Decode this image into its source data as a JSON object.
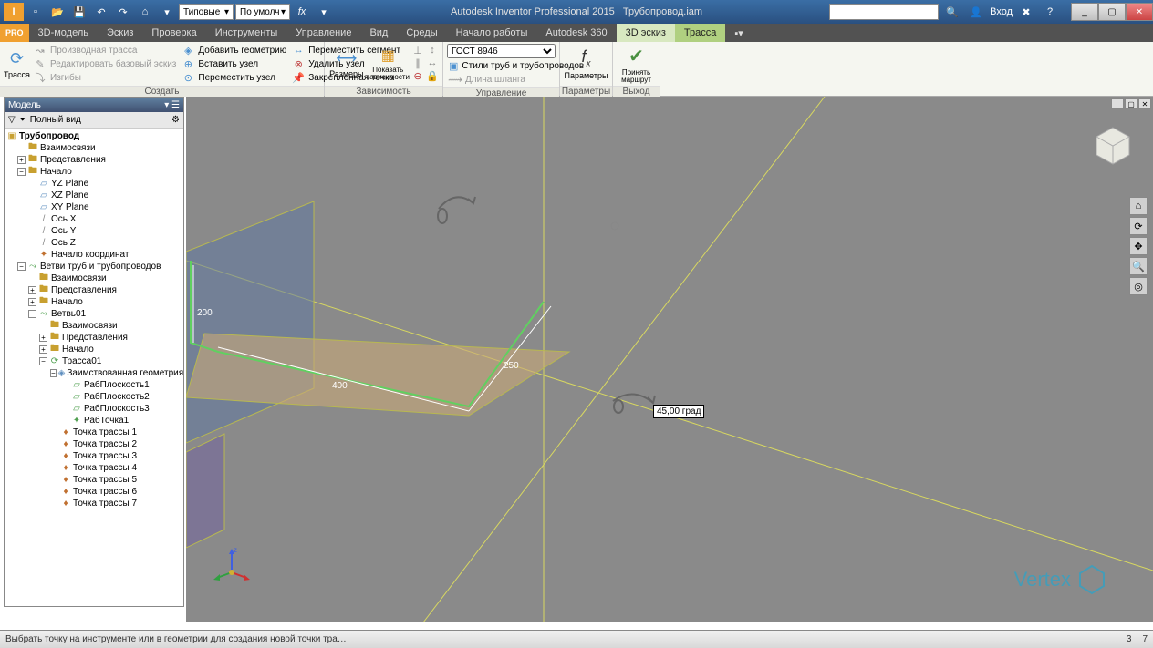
{
  "title": {
    "app": "Autodesk Inventor Professional 2015",
    "file": "Трубопровод.iam"
  },
  "qat": {
    "style_dd": "Типовые",
    "layer_dd": "По умолч"
  },
  "login": "Вход",
  "tabs": {
    "pro": "PRO",
    "items": [
      "3D-модель",
      "Эскиз",
      "Проверка",
      "Инструменты",
      "Управление",
      "Вид",
      "Среды",
      "Начало работы",
      "Autodesk 360",
      "3D эскиз",
      "Трасса"
    ]
  },
  "ribbon": {
    "g1": {
      "big": "Трасса",
      "rows": {
        "a": "Производная трасса",
        "b": "Редактировать базовый эскиз",
        "c": "Изгибы",
        "d": "Добавить геометрию",
        "e": "Вставить узел",
        "f": "Переместить узел",
        "g": "Переместить сегмент",
        "h": "Удалить узел",
        "i": "Закрепленная точка"
      },
      "label": "Создать"
    },
    "g2": {
      "big1": "Размеры",
      "big2": "Показать зависимости",
      "label": "Зависимость"
    },
    "g3": {
      "dd": "ГОСТ 8946",
      "row1": "Стили труб и трубопроводов",
      "row2": "Длина шланга",
      "label": "Управление"
    },
    "g4": {
      "big": "Параметры",
      "label": "Параметры"
    },
    "g5": {
      "big": "Принять маршрут",
      "label": "Выход"
    }
  },
  "panel": {
    "title": "Модель",
    "filter": "Полный вид",
    "tree": {
      "root": "Трубопровод",
      "n1": "Взаимосвязи",
      "n2": "Представления",
      "n3": "Начало",
      "p_yz": "YZ Plane",
      "p_xz": "XZ Plane",
      "p_xy": "XY Plane",
      "ax_x": "Ось X",
      "ax_y": "Ось Y",
      "ax_z": "Ось Z",
      "origin": "Начало координат",
      "branches": "Ветви труб и трубопроводов",
      "b1": "Взаимосвязи",
      "b2": "Представления",
      "b3": "Начало",
      "branch": "Ветвь01",
      "br1": "Взаимосвязи",
      "br2": "Представления",
      "br3": "Начало",
      "route": "Трасса01",
      "geom": "Заимствованная геометрия",
      "wp1": "РабПлоскость1",
      "wp2": "РабПлоскость2",
      "wp3": "РабПлоскость3",
      "wpt1": "РабТочка1",
      "rp1": "Точка трассы 1",
      "rp2": "Точка трассы 2",
      "rp3": "Точка трассы 3",
      "rp4": "Точка трассы 4",
      "rp5": "Точка трассы 5",
      "rp6": "Точка трассы 6",
      "rp7": "Точка трассы 7"
    }
  },
  "viewport": {
    "dim_200": "200",
    "dim_250": "250",
    "dim_400": "400",
    "angle": "45,00 град"
  },
  "watermark": "Vertex",
  "status": {
    "prompt": "Выбрать точку на инструменте или в геометрии для создания новой точки тра…",
    "n1": "3",
    "n2": "7"
  }
}
